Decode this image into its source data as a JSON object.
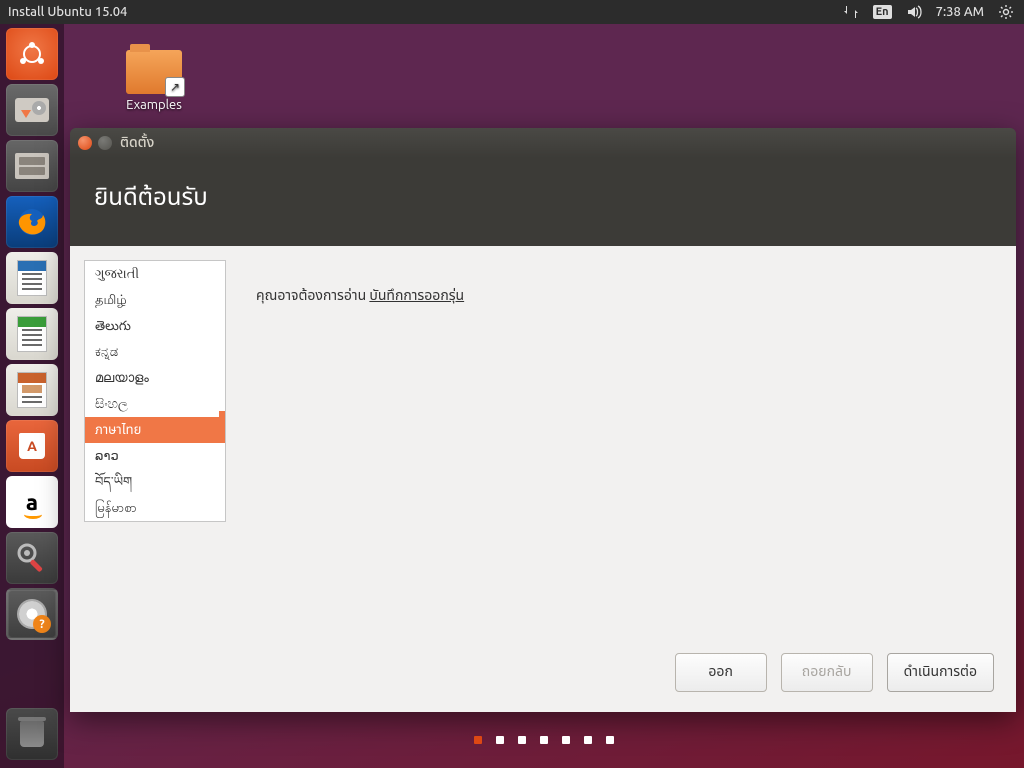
{
  "menubar": {
    "title": "Install Ubuntu 15.04",
    "lang_indicator": "En",
    "time": "7:38 AM"
  },
  "desktop": {
    "examples_label": "Examples"
  },
  "launcher": {
    "items": [
      {
        "name": "ubuntu-dash"
      },
      {
        "name": "install-drive"
      },
      {
        "name": "files"
      },
      {
        "name": "firefox"
      },
      {
        "name": "libreoffice-writer"
      },
      {
        "name": "libreoffice-calc"
      },
      {
        "name": "libreoffice-impress"
      },
      {
        "name": "software-center"
      },
      {
        "name": "amazon"
      },
      {
        "name": "system-settings"
      },
      {
        "name": "ubiquity-installer"
      },
      {
        "name": "trash"
      }
    ]
  },
  "installer": {
    "window_title": "ติดตั้ง",
    "heading": "ยินดีต้อนรับ",
    "release_prompt": "คุณอาจต้องการอ่าน ",
    "release_link": "บันทึกการออกรุ่น",
    "languages": [
      "ગુજરાતી",
      "தமிழ்",
      "తెలుగు",
      "ಕನ್ನಡ",
      "മലയാളം",
      "සිංහල",
      "ภาษาไทย",
      "ລາວ",
      "བོད་ཡིག",
      "မြန်မာစာ"
    ],
    "selected_index": 6,
    "buttons": {
      "quit": "ออก",
      "back": "ถอยกลับ",
      "continue": "ดำเนินการต่อ"
    },
    "pager": {
      "total": 7,
      "active": 0
    }
  }
}
